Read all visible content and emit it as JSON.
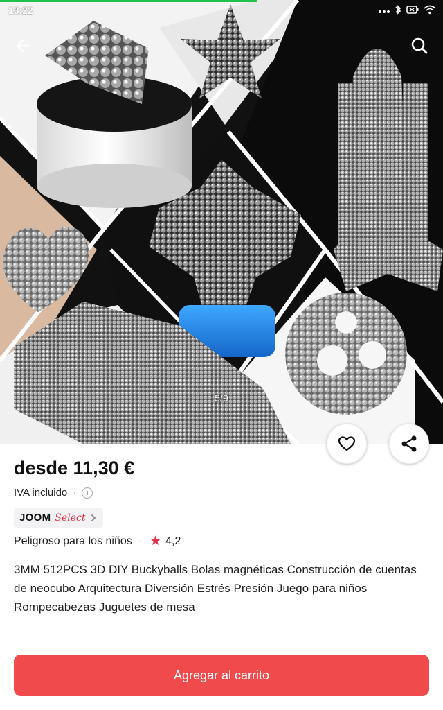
{
  "status_bar": {
    "time": "13:22",
    "icons": [
      "more-dots-icon",
      "bluetooth-icon",
      "battery-icon",
      "wifi-icon"
    ]
  },
  "gallery": {
    "counter": "5/9",
    "progress": 0.58,
    "images": [
      "cube-in-tin",
      "star",
      "rocket",
      "heart",
      "cross-sculpture",
      "vehicle",
      "sphere"
    ]
  },
  "product": {
    "price": "desde 11,30 €",
    "vat": "IVA incluido",
    "badge": {
      "brand": "JOOM",
      "tier": "Select"
    },
    "warning": "Peligroso para los niños",
    "rating": "4,2",
    "title": "3MM 512PCS 3D DIY Buckyballs Bolas magnéticas Construcción de cuentas de neocubo Arquitectura Diversión Estrés Presión Juego para niños Rompecabezas Juguetes de mesa"
  },
  "actions": {
    "add_to_cart": "Agregar al carrito"
  },
  "colors": {
    "accent": "#f04a4c",
    "star": "#e5304a",
    "progress": "#21c24a"
  }
}
